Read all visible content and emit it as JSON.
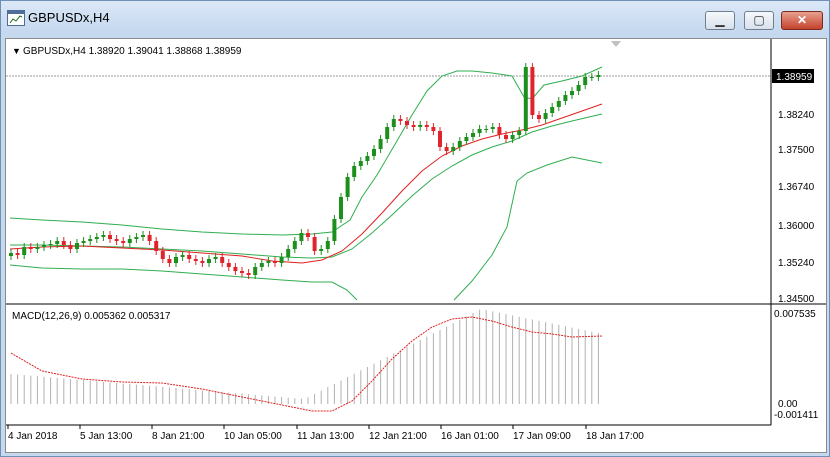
{
  "window": {
    "title": "GBPUSDx,H4",
    "buttons": {
      "minimize": "▁",
      "maximize": "▢",
      "close": "✕"
    },
    "icons": {
      "app": "chart-window-icon"
    }
  },
  "chart": {
    "header": "GBPUSDx,H4  1.38920 1.39041 1.38868 1.38959",
    "header_marker": "▼",
    "current_price": "1.38959",
    "price_axis": [
      "1.38240",
      "1.37500",
      "1.36740",
      "1.36000",
      "1.35240",
      "1.34500"
    ],
    "macd_label": "MACD(12,26,9) 0.005362 0.005317",
    "macd_axis": [
      "0.007535",
      "0.00",
      "-0.001411"
    ],
    "time_axis": [
      "4 Jan 2018",
      "5 Jan 13:00",
      "8 Jan 21:00",
      "10 Jan 05:00",
      "11 Jan 13:00",
      "12 Jan 21:00",
      "16 Jan 01:00",
      "17 Jan 09:00",
      "18 Jan 17:00"
    ],
    "colors": {
      "bull": "#1c8f1c",
      "bear": "#e0242c",
      "band": "#2fae4f",
      "ma": "#e02020",
      "hist": "#b0b0b0",
      "signal": "#e02020"
    }
  }
}
